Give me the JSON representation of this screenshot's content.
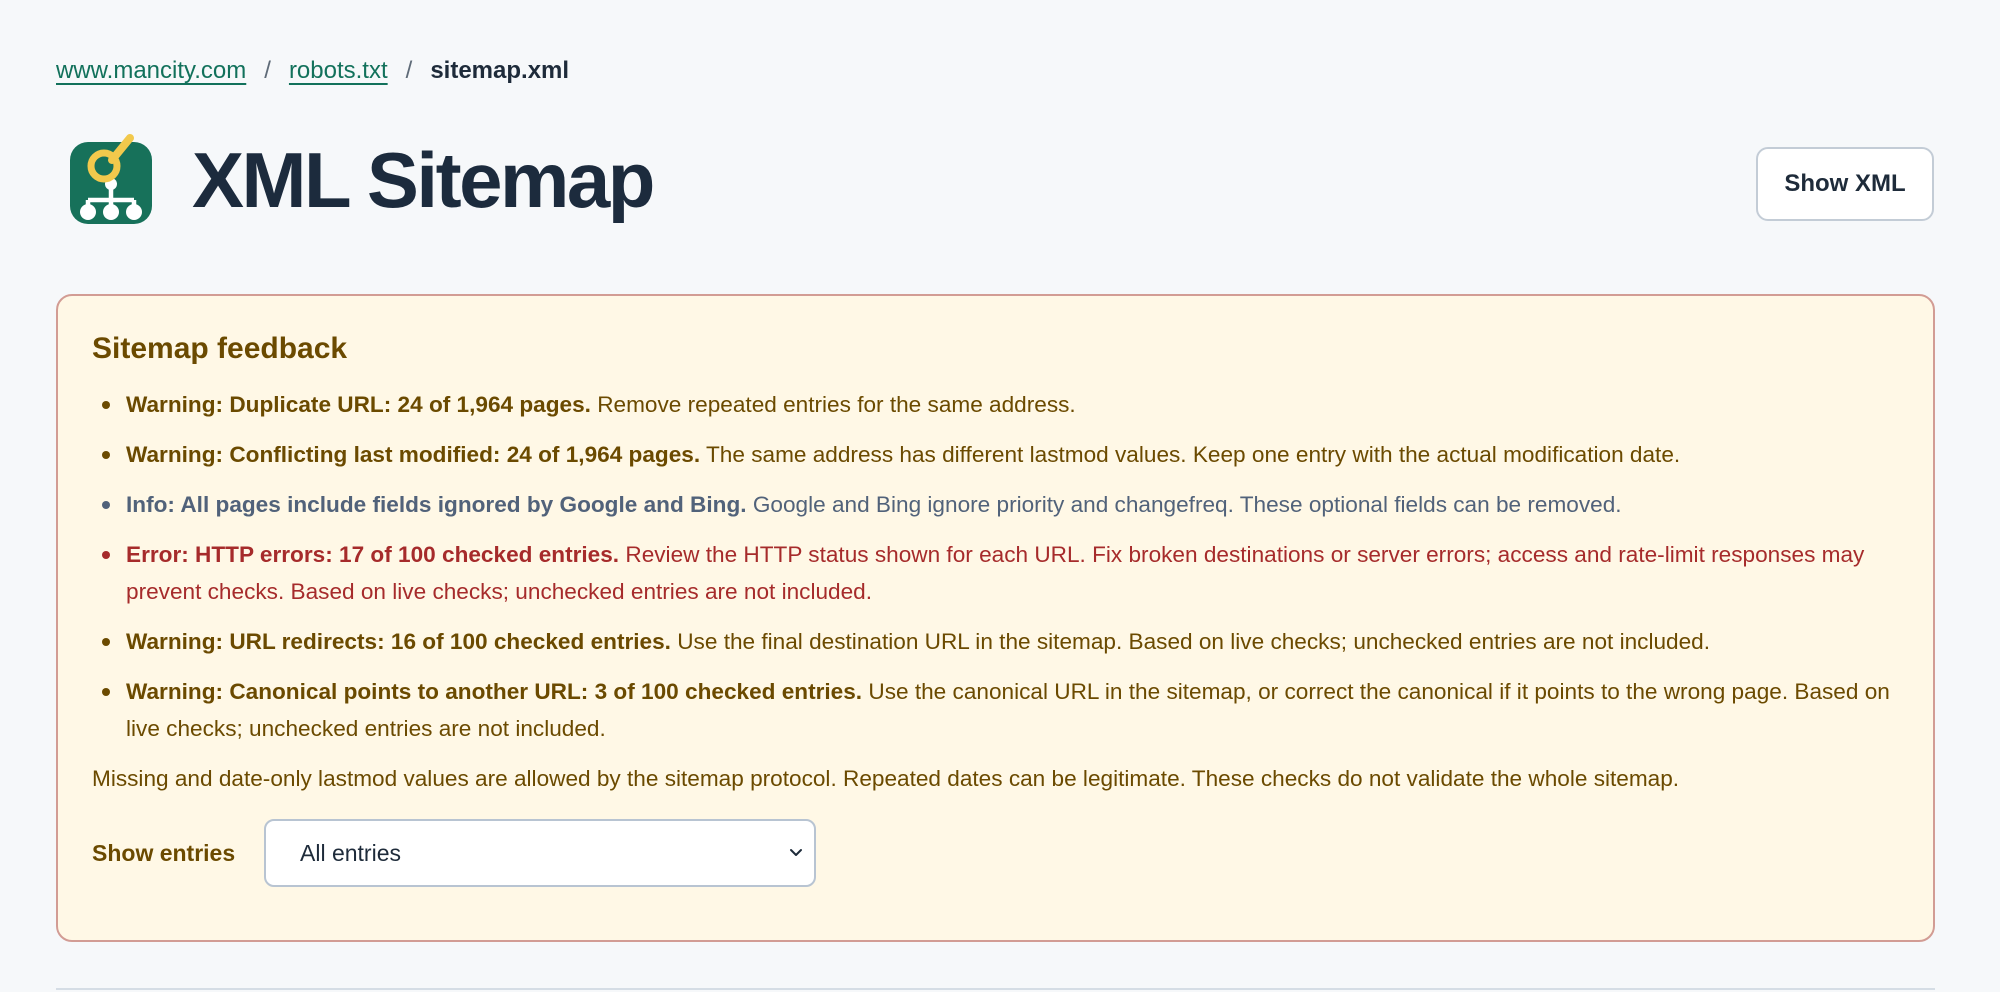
{
  "breadcrumb": {
    "items": [
      {
        "label": "www.mancity.com"
      },
      {
        "label": "robots.txt"
      }
    ],
    "separator": "/",
    "current": "sitemap.xml"
  },
  "header": {
    "title": "XML Sitemap",
    "logo_icon": "sitemap-magnifier-icon",
    "show_xml_label": "Show XML"
  },
  "feedback": {
    "title": "Sitemap feedback",
    "items": [
      {
        "level": "warning",
        "lead": "Warning: Duplicate URL: 24 of 1,964 pages.",
        "text": "Remove repeated entries for the same address."
      },
      {
        "level": "warning",
        "lead": "Warning: Conflicting last modified: 24 of 1,964 pages.",
        "text": "The same address has different lastmod values. Keep one entry with the actual modification date."
      },
      {
        "level": "info",
        "lead": "Info: All pages include fields ignored by Google and Bing.",
        "text": "Google and Bing ignore priority and changefreq. These optional fields can be removed."
      },
      {
        "level": "error",
        "lead": "Error: HTTP errors: 17 of 100 checked entries.",
        "text": "Review the HTTP status shown for each URL. Fix broken destinations or server errors; access and rate-limit responses may prevent checks. Based on live checks; unchecked entries are not included."
      },
      {
        "level": "warning",
        "lead": "Warning: URL redirects: 16 of 100 checked entries.",
        "text": "Use the final destination URL in the sitemap. Based on live checks; unchecked entries are not included."
      },
      {
        "level": "warning",
        "lead": "Warning: Canonical points to another URL: 3 of 100 checked entries.",
        "text": "Use the canonical URL in the sitemap, or correct the canonical if it points to the wrong page. Based on live checks; unchecked entries are not included."
      }
    ],
    "note": "Missing and date-only lastmod values are allowed by the sitemap protocol. Repeated dates can be legitimate. These checks do not validate the whole sitemap.",
    "show_entries": {
      "label": "Show entries",
      "selected": "All entries"
    }
  },
  "colors": {
    "accent_link": "#12715b",
    "warning_text": "#6b4a00",
    "info_text": "#51627a",
    "error_text": "#a62b2b",
    "panel_bg": "#fff8e6",
    "panel_border": "#d29c94",
    "logo_bg": "#17715a",
    "logo_magnifier": "#f2c94c"
  }
}
